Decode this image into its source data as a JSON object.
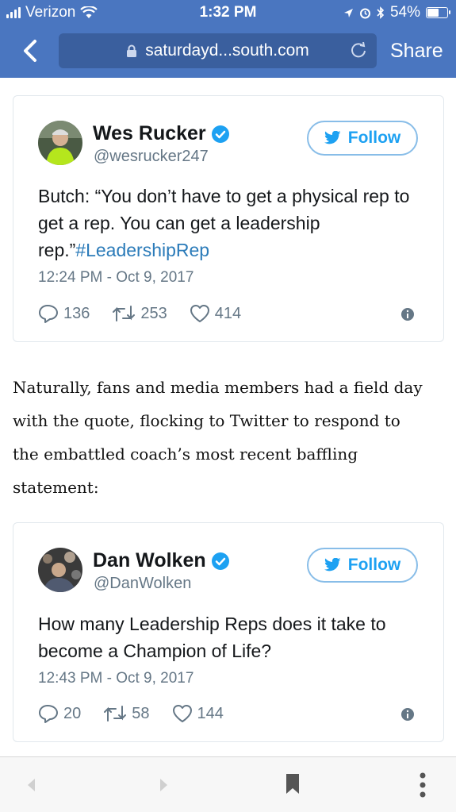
{
  "status_bar": {
    "carrier": "Verizon",
    "time": "1:32 PM",
    "battery_percent": "54%",
    "battery_level": 0.54
  },
  "browser": {
    "url": "saturdayd...south.com",
    "share_label": "Share"
  },
  "tweets": [
    {
      "name": "Wes Rucker",
      "handle": "@wesrucker247",
      "follow_label": "Follow",
      "text": "Butch: “You don’t have to get a physical rep to get a rep. You can get a leadership rep.”",
      "hashtag": "#LeadershipRep",
      "timestamp": "12:24 PM - Oct 9, 2017",
      "replies": "136",
      "retweets": "253",
      "likes": "414"
    },
    {
      "name": "Dan Wolken",
      "handle": "@DanWolken",
      "follow_label": "Follow",
      "text": "How many Leadership Reps does it take to become a Champion of Life?",
      "timestamp": "12:43 PM - Oct 9, 2017",
      "replies": "20",
      "retweets": "58",
      "likes": "144"
    }
  ],
  "article": {
    "lines": [
      "Naturally, fans and media members had a field day",
      "with the quote, flocking to Twitter to respond to",
      "the embattled coach’s most recent baffling",
      "statement:"
    ]
  },
  "colors": {
    "nav_blue": "#4a76c0",
    "twitter_blue": "#1da1f2",
    "hashtag_blue": "#2b7bb9",
    "muted_gray": "#657786"
  },
  "icons": [
    "signal-icon",
    "wifi-icon",
    "location-icon",
    "alarm-icon",
    "bluetooth-icon",
    "battery-icon",
    "back-chevron-icon",
    "lock-icon",
    "reload-icon",
    "verified-icon",
    "twitter-bird-icon",
    "reply-icon",
    "retweet-icon",
    "like-icon",
    "info-icon",
    "back-arrow-icon",
    "forward-arrow-icon",
    "bookmark-icon",
    "more-icon"
  ]
}
